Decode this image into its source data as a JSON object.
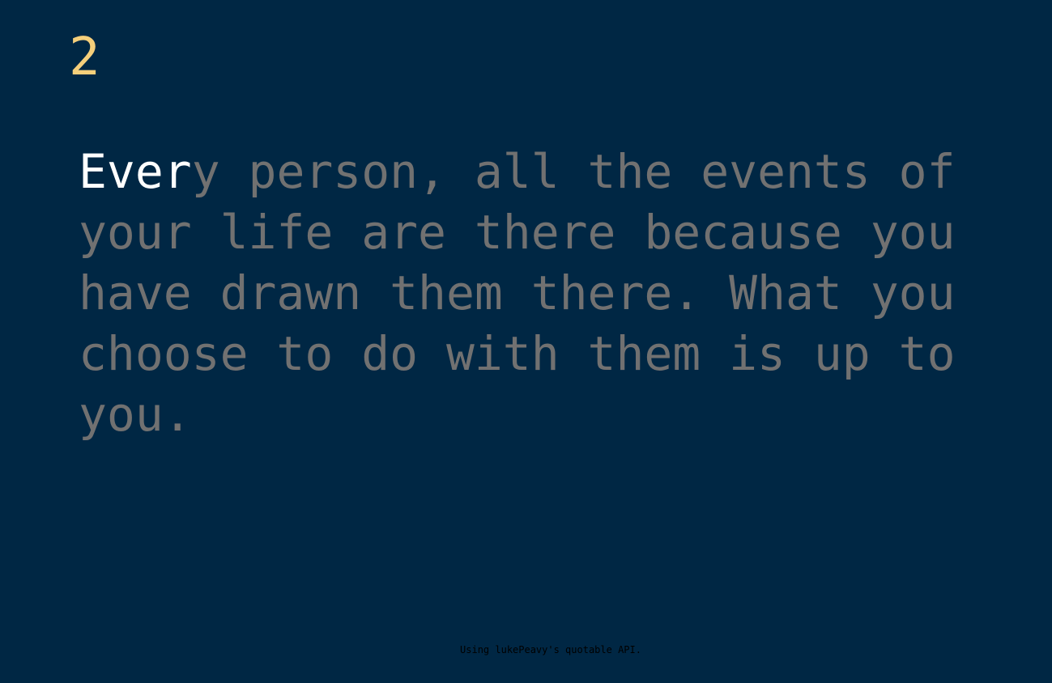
{
  "counter": {
    "value": "2"
  },
  "quote": {
    "typed": "Ever",
    "remaining": "y person, all the events of your life are there because you have drawn them there. What you choose to do with them is up to you."
  },
  "footer": {
    "text": "Using lukePeavy's quotable API."
  },
  "colors": {
    "background": "#002744",
    "counter": "#f5cf7b",
    "typed_text": "#ffffff",
    "remaining_text": "#717171",
    "footer_text": "#000000"
  }
}
